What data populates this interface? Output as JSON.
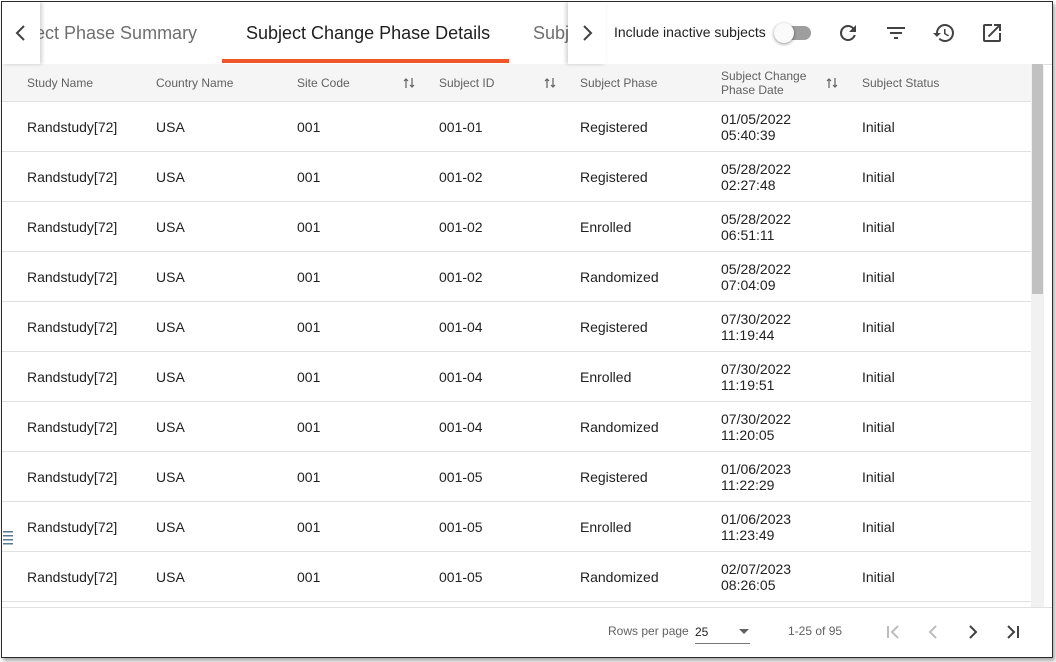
{
  "tabs": [
    {
      "label": "ect Phase Summary"
    },
    {
      "label": "Subject Change Phase Details"
    },
    {
      "label": "Subj"
    }
  ],
  "toolbar": {
    "include_inactive_label": "Include inactive subjects",
    "include_inactive_on": false
  },
  "icons": {
    "nav_left": "chevron-left-icon",
    "nav_right": "chevron-right-icon",
    "refresh": "refresh-icon",
    "filter": "filter-icon",
    "history": "history-icon",
    "open_external": "open-in-new-icon",
    "sort": "sort-icon",
    "first_page": "first-page-icon",
    "prev_page": "prev-page-icon",
    "next_page": "next-page-icon",
    "last_page": "last-page-icon"
  },
  "colors": {
    "accent": "#f0562a",
    "header_bg": "#f5f5f5",
    "toggle_off": "#9e9e9e"
  },
  "table": {
    "columns": [
      {
        "label": "Study Name"
      },
      {
        "label": "Country Name"
      },
      {
        "label": "Site Code"
      },
      {
        "label": "Subject ID"
      },
      {
        "label": "Subject Phase"
      },
      {
        "label": "Subject Change Phase Date"
      },
      {
        "label": "Subject Status"
      }
    ],
    "rows": [
      {
        "study": "Randstudy[72]",
        "country": "USA",
        "site": "001",
        "subject": "001-01",
        "phase": "Registered",
        "date": "01/05/2022",
        "time": "05:40:39",
        "status": "Initial"
      },
      {
        "study": "Randstudy[72]",
        "country": "USA",
        "site": "001",
        "subject": "001-02",
        "phase": "Registered",
        "date": "05/28/2022",
        "time": "02:27:48",
        "status": "Initial"
      },
      {
        "study": "Randstudy[72]",
        "country": "USA",
        "site": "001",
        "subject": "001-02",
        "phase": "Enrolled",
        "date": "05/28/2022",
        "time": "06:51:11",
        "status": "Initial"
      },
      {
        "study": "Randstudy[72]",
        "country": "USA",
        "site": "001",
        "subject": "001-02",
        "phase": "Randomized",
        "date": "05/28/2022",
        "time": "07:04:09",
        "status": "Initial"
      },
      {
        "study": "Randstudy[72]",
        "country": "USA",
        "site": "001",
        "subject": "001-04",
        "phase": "Registered",
        "date": "07/30/2022",
        "time": "11:19:44",
        "status": "Initial"
      },
      {
        "study": "Randstudy[72]",
        "country": "USA",
        "site": "001",
        "subject": "001-04",
        "phase": "Enrolled",
        "date": "07/30/2022",
        "time": "11:19:51",
        "status": "Initial"
      },
      {
        "study": "Randstudy[72]",
        "country": "USA",
        "site": "001",
        "subject": "001-04",
        "phase": "Randomized",
        "date": "07/30/2022",
        "time": "11:20:05",
        "status": "Initial"
      },
      {
        "study": "Randstudy[72]",
        "country": "USA",
        "site": "001",
        "subject": "001-05",
        "phase": "Registered",
        "date": "01/06/2023",
        "time": "11:22:29",
        "status": "Initial"
      },
      {
        "study": "Randstudy[72]",
        "country": "USA",
        "site": "001",
        "subject": "001-05",
        "phase": "Enrolled",
        "date": "01/06/2023",
        "time": "11:23:49",
        "status": "Initial"
      },
      {
        "study": "Randstudy[72]",
        "country": "USA",
        "site": "001",
        "subject": "001-05",
        "phase": "Randomized",
        "date": "02/07/2023",
        "time": "08:26:05",
        "status": "Initial"
      }
    ]
  },
  "pagination": {
    "rows_per_page_label": "Rows per page",
    "rows_per_page_value": "25",
    "range_text": "1-25 of 95"
  }
}
